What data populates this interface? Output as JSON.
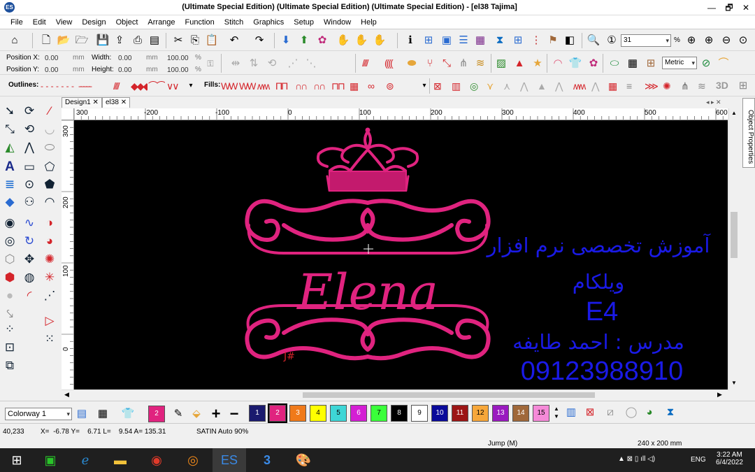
{
  "window": {
    "title": "(Ultimate Special Edition) (Ultimate Special Edition) (Ultimate Special Edition) - [el38      Tajima]",
    "minimize": "—",
    "restore": "🗗",
    "close": "✕"
  },
  "menu": [
    "File",
    "Edit",
    "View",
    "Design",
    "Object",
    "Arrange",
    "Function",
    "Stitch",
    "Graphics",
    "Setup",
    "Window",
    "Help"
  ],
  "toolbar1": {
    "zoom_value": "31",
    "zoom_unit": "%"
  },
  "toolbar2": {
    "position_x_label": "Position X:",
    "position_x_value": "0.00",
    "position_y_label": "Position Y:",
    "position_y_value": "0.00",
    "unit_mm": "mm",
    "width_label": "Width:",
    "width_value": "0.00",
    "height_label": "Height:",
    "height_value": "0.00",
    "scale_w": "100.00",
    "scale_h": "100.00",
    "unit_pct": "%",
    "units_select": "Metric"
  },
  "toolbar3": {
    "outlines_label": "Outlines:",
    "fills_label": "Fills:",
    "threed_label": "3D"
  },
  "tabs": [
    {
      "label": "Design1",
      "close": "✕"
    },
    {
      "label": "el38",
      "close": "✕"
    }
  ],
  "ruler_h": [
    "300",
    "-200",
    "-100",
    "0",
    "100",
    "200",
    "300",
    "400",
    "500",
    "600"
  ],
  "ruler_v": [
    "300",
    "200",
    "100",
    "0"
  ],
  "side_panel": {
    "label": "Object Properties"
  },
  "design": {
    "name_text": "Elena",
    "jump_marker": "J#"
  },
  "overlay": {
    "line1": "آموزش تخصصی نرم افزار",
    "line2": "ویلکام",
    "line3": "E4",
    "line4": "مدرس : احمد طایفه",
    "line5": "09123988910"
  },
  "colorbar": {
    "colorway": "Colorway 1",
    "current_color": "2",
    "swatches": [
      {
        "num": "1",
        "color": "#1a1a6e"
      },
      {
        "num": "2",
        "color": "#e0237f"
      },
      {
        "num": "3",
        "color": "#f07a1a"
      },
      {
        "num": "4",
        "color": "#ffff00"
      },
      {
        "num": "5",
        "color": "#3ed6d6"
      },
      {
        "num": "6",
        "color": "#d41fd4"
      },
      {
        "num": "7",
        "color": "#3aff3a"
      },
      {
        "num": "8",
        "color": "#000000"
      },
      {
        "num": "9",
        "color": "#ffffff"
      },
      {
        "num": "10",
        "color": "#0a0a9a"
      },
      {
        "num": "11",
        "color": "#9c1515"
      },
      {
        "num": "12",
        "color": "#f7a73a"
      },
      {
        "num": "13",
        "color": "#9a1abf"
      },
      {
        "num": "14",
        "color": "#a0683a"
      },
      {
        "num": "15",
        "color": "#f58ad8"
      }
    ]
  },
  "status": {
    "stitch_count": "40,233",
    "coords": "X=  -6.78 Y=    6.71 L=    9.54 A= 135.31",
    "stitch_type": "SATIN Auto 90%",
    "jump": "Jump (M)",
    "size": "240 x 200 mm"
  },
  "taskbar": {
    "time": "3:22 AM",
    "date": "6/4/2022",
    "lang": "ENG"
  }
}
